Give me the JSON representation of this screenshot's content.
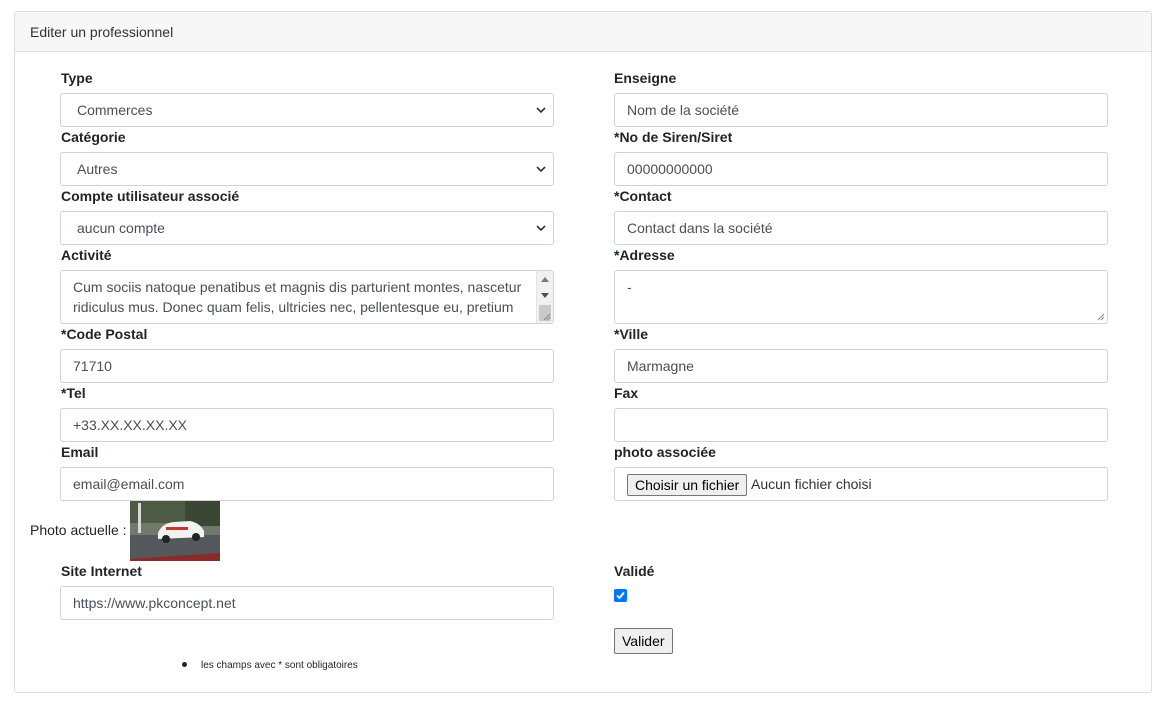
{
  "header": {
    "title": "Editer un professionnel"
  },
  "left": {
    "type": {
      "label": "Type",
      "value": "Commerces"
    },
    "categorie": {
      "label": "Catégorie",
      "value": "Autres"
    },
    "compte": {
      "label": "Compte utilisateur associé",
      "value": "aucun compte"
    },
    "activite": {
      "label": "Activité",
      "value": "Cum sociis natoque penatibus et magnis dis parturient montes, nascetur ridiculus mus. Donec quam felis, ultricies nec, pellentesque eu, pretium"
    },
    "code_postal": {
      "label": "*Code Postal",
      "value": "71710"
    },
    "tel": {
      "label": "*Tel",
      "value": "+33.XX.XX.XX.XX"
    },
    "email": {
      "label": "Email",
      "value": "email@email.com"
    },
    "site": {
      "label": "Site Internet",
      "value": "https://www.pkconcept.net"
    }
  },
  "right": {
    "enseigne": {
      "label": "Enseigne",
      "value": "Nom de la société"
    },
    "siren": {
      "label": "*No de Siren/Siret",
      "value": "00000000000"
    },
    "contact": {
      "label": "*Contact",
      "value": "Contact dans la société"
    },
    "adresse": {
      "label": "*Adresse",
      "value": "-"
    },
    "ville": {
      "label": "*Ville",
      "value": "Marmagne"
    },
    "fax": {
      "label": "Fax",
      "value": ""
    },
    "photo": {
      "label": "photo associée",
      "button": "Choisir un fichier",
      "status": "Aucun fichier choisi"
    },
    "valide": {
      "label": "Validé",
      "checked": true
    },
    "submit": "Valider"
  },
  "photo_actuelle": "Photo actuelle :",
  "note": "les champs avec * sont obligatoires",
  "colors": {
    "checkbox": "#0075ff",
    "header_bg": "#f7f7f7",
    "border": "#ced4da"
  }
}
